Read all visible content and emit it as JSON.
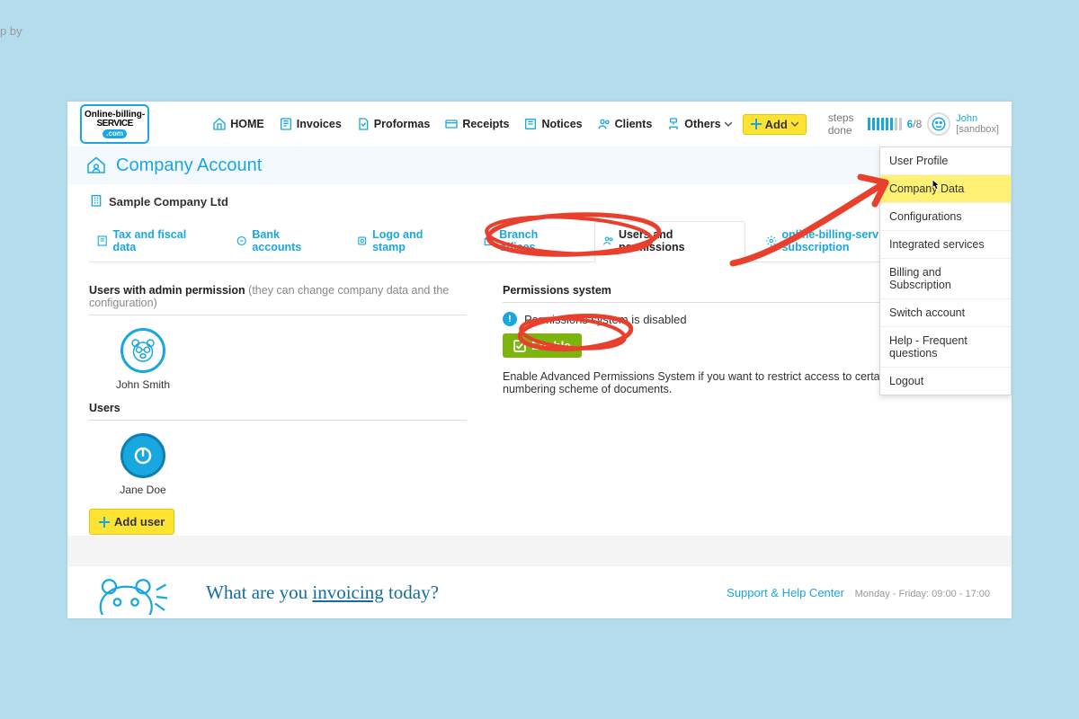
{
  "external_label": "p by",
  "logo": {
    "l1": "Online-billing-",
    "l2": "SERVICE",
    "l3": ".com"
  },
  "nav": {
    "home": "HOME",
    "invoices": "Invoices",
    "proformas": "Proformas",
    "receipts": "Receipts",
    "notices": "Notices",
    "clients": "Clients",
    "others": "Others",
    "add": "Add"
  },
  "steps": {
    "label": "steps done",
    "done": 6,
    "total": 8
  },
  "user": {
    "name": "John",
    "mode": "[sandbox]"
  },
  "dropdown": {
    "items": [
      "User Profile",
      "Company Data",
      "Configurations",
      "Integrated services",
      "Billing and Subscription",
      "Switch account",
      "Help - Frequent questions",
      "Logout"
    ],
    "highlight_index": 1
  },
  "title": "Company Account",
  "company": "Sample Company Ltd",
  "subtabs": {
    "tax": "Tax and fiscal data",
    "bank": "Bank accounts",
    "logo": "Logo and stamp",
    "branch": "Branch offices",
    "users": "Users and permissions",
    "sub": "online-billing-service.com subscription"
  },
  "left": {
    "admins_head": "Users with admin permission",
    "admins_note": "(they can change company data and the configuration)",
    "admin_name": "John Smith",
    "users_head": "Users",
    "user_name": "Jane Doe",
    "add_user": "Add user"
  },
  "right": {
    "head": "Permissions system",
    "status": "Permissions system is disabled",
    "enable": "Enable",
    "desc": "Enable Advanced Permissions System if you want to restrict access to certain documents or numbering scheme of documents."
  },
  "footer": {
    "slogan_a": "What are you ",
    "slogan_b": "invoicing",
    "slogan_c": " today?",
    "support": "Support & Help Center",
    "hours": "Monday - Friday: 09:00 - 17:00"
  }
}
